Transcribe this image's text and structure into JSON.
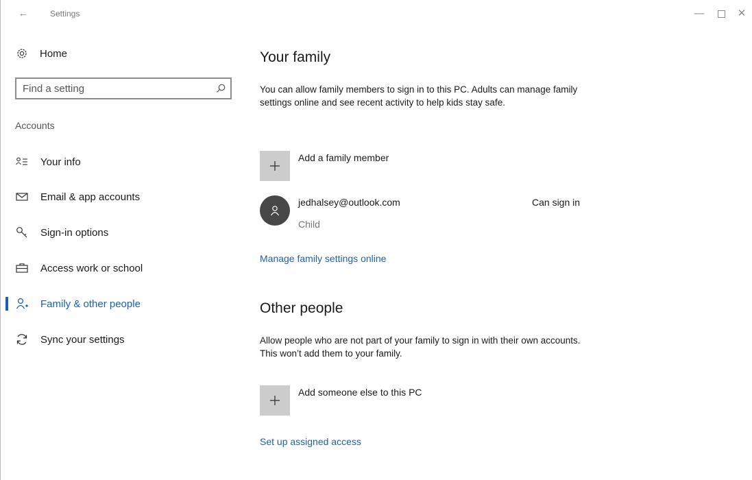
{
  "window": {
    "title": "Settings",
    "back_glyph": "←",
    "minimize_glyph": "—",
    "close_glyph": "✕"
  },
  "sidebar": {
    "home_label": "Home",
    "search_placeholder": "Find a setting",
    "section_label": "Accounts",
    "items": [
      {
        "label": "Your info",
        "icon": "person-list-icon"
      },
      {
        "label": "Email & app accounts",
        "icon": "mail-icon"
      },
      {
        "label": "Sign-in options",
        "icon": "key-icon"
      },
      {
        "label": "Access work or school",
        "icon": "briefcase-icon"
      },
      {
        "label": "Family & other people",
        "icon": "add-person-icon",
        "active": true
      },
      {
        "label": "Sync your settings",
        "icon": "sync-icon"
      }
    ]
  },
  "main": {
    "family": {
      "title": "Your family",
      "description": "You can allow family members to sign in to this PC. Adults can manage family settings online and see recent activity to help kids stay safe.",
      "add_label": "Add a family member",
      "member": {
        "email": "jedhalsey@outlook.com",
        "role": "Child",
        "status": "Can sign in"
      },
      "manage_link": "Manage family settings online"
    },
    "other": {
      "title": "Other people",
      "description": "Allow people who are not part of your family to sign in with their own accounts. This won’t add them to your family.",
      "add_label": "Add someone else to this PC",
      "assigned_link": "Set up assigned access"
    }
  },
  "colors": {
    "accent": "#1a5fb4",
    "link": "#1d61a8",
    "tile": "#cccccc",
    "avatar": "#474747"
  }
}
